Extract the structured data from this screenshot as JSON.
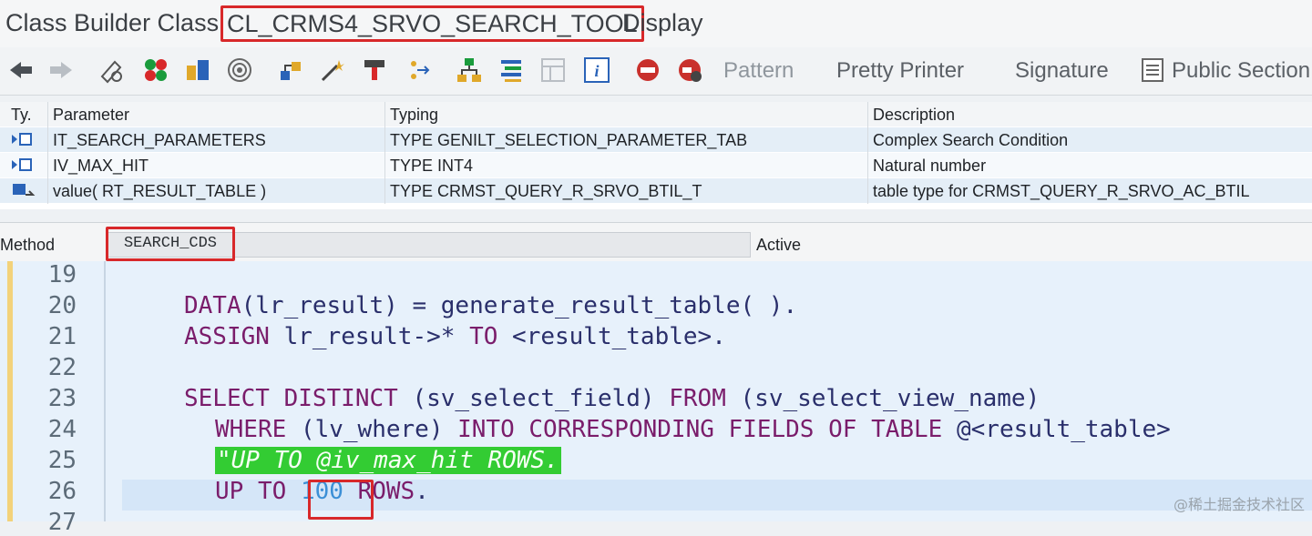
{
  "window": {
    "title_prefix": "Class Builder Class",
    "class_name": "CL_CRMS4_SRVO_SEARCH_TOOL",
    "title_suffix": "Display"
  },
  "toolbar": {
    "icons": [
      "back-arrow-icon",
      "forward-arrow-icon",
      "toggle-display-change-icon",
      "other-object-icon",
      "active-inactive-icon",
      "check-icon",
      "activate-icon",
      "where-used-icon",
      "display-object-list-icon",
      "navigation-window-icon",
      "hierarchy-icon",
      "local-types-icon",
      "layout-icon",
      "info-icon",
      "set-breakpoint-icon",
      "session-breakpoint-icon"
    ],
    "pattern_label": "Pattern",
    "pretty_printer_label": "Pretty Printer",
    "signature_label": "Signature",
    "public_section_label": "Public Section"
  },
  "parameters": {
    "headers": {
      "type": "Ty.",
      "parameter": "Parameter",
      "typing": "Typing",
      "description": "Description"
    },
    "rows": [
      {
        "type_icon": "importing-icon",
        "parameter": "IT_SEARCH_PARAMETERS",
        "typing": "TYPE GENILT_SELECTION_PARAMETER_TAB",
        "description": "Complex Search Condition"
      },
      {
        "type_icon": "importing-icon",
        "parameter": "IV_MAX_HIT",
        "typing": "TYPE INT4",
        "description": "Natural number"
      },
      {
        "type_icon": "returning-icon",
        "parameter": "value( RT_RESULT_TABLE )",
        "typing": "TYPE CRMST_QUERY_R_SRVO_BTIL_T",
        "description": "table type for CRMST_QUERY_R_SRVO_AC_BTIL"
      }
    ]
  },
  "method": {
    "label": "Method",
    "name": "SEARCH_CDS",
    "status": "Active"
  },
  "editor": {
    "line_numbers": [
      "19",
      "20",
      "21",
      "22",
      "23",
      "24",
      "25",
      "26",
      "27"
    ],
    "line20": {
      "kw": "DATA",
      "rest": "(lr_result) = generate_result_table( )."
    },
    "line21": {
      "kw1": "ASSIGN",
      "mid": " lr_result->* ",
      "kw2": "TO",
      "rest": " <result_table>."
    },
    "line23": {
      "kw1": "SELECT DISTINCT",
      "mid1": " (sv_select_field) ",
      "kw2": "FROM",
      "rest": " (sv_select_view_name)"
    },
    "line24": {
      "kw1": "WHERE",
      "mid1": " (lv_where) ",
      "kw2": "INTO CORRESPONDING FIELDS OF TABLE",
      "rest": " @<result_table>"
    },
    "line25": {
      "comment": "\"UP TO @iv_max_hit ROWS."
    },
    "line26": {
      "kw1": "UP TO",
      "num": "100",
      "kw2": "ROWS",
      "rest": "."
    }
  },
  "watermark": "@稀土掘金技术社区",
  "colors": {
    "highlight_red": "#d8282a",
    "comment_green": "#33cc33",
    "keyword": "#7a1d6b"
  }
}
